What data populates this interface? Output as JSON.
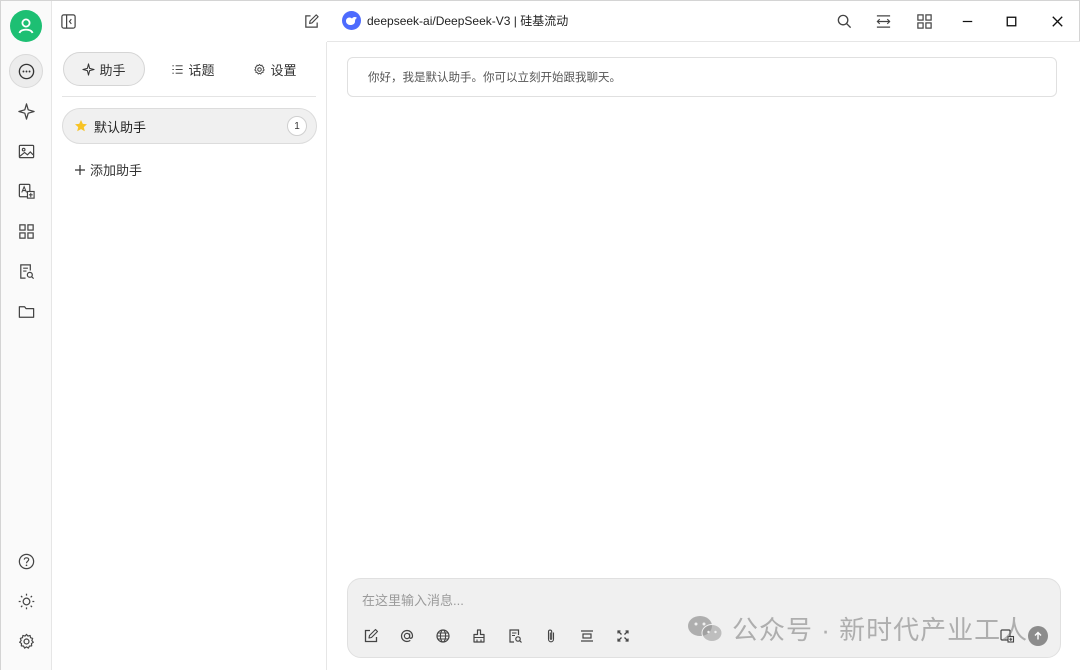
{
  "window": {
    "model_title": "deepseek-ai/DeepSeek-V3 | 硅基流动"
  },
  "sidebar": {
    "tabs": [
      {
        "label": "助手",
        "icon": "sparkle-icon"
      },
      {
        "label": "话题",
        "icon": "list-icon"
      },
      {
        "label": "设置",
        "icon": "gear-icon"
      }
    ],
    "assistants": [
      {
        "name": "默认助手",
        "count": "1"
      }
    ],
    "add_label": "添加助手"
  },
  "chat": {
    "greeting": "你好，我是默认助手。你可以立刻开始跟我聊天。",
    "input_placeholder": "在这里输入消息..."
  },
  "watermark": {
    "text": "公众号 · 新时代产业工人"
  },
  "colors": {
    "avatar": "#1dbf73",
    "model_logo": "#4d6bfe",
    "star": "#f7c325"
  }
}
